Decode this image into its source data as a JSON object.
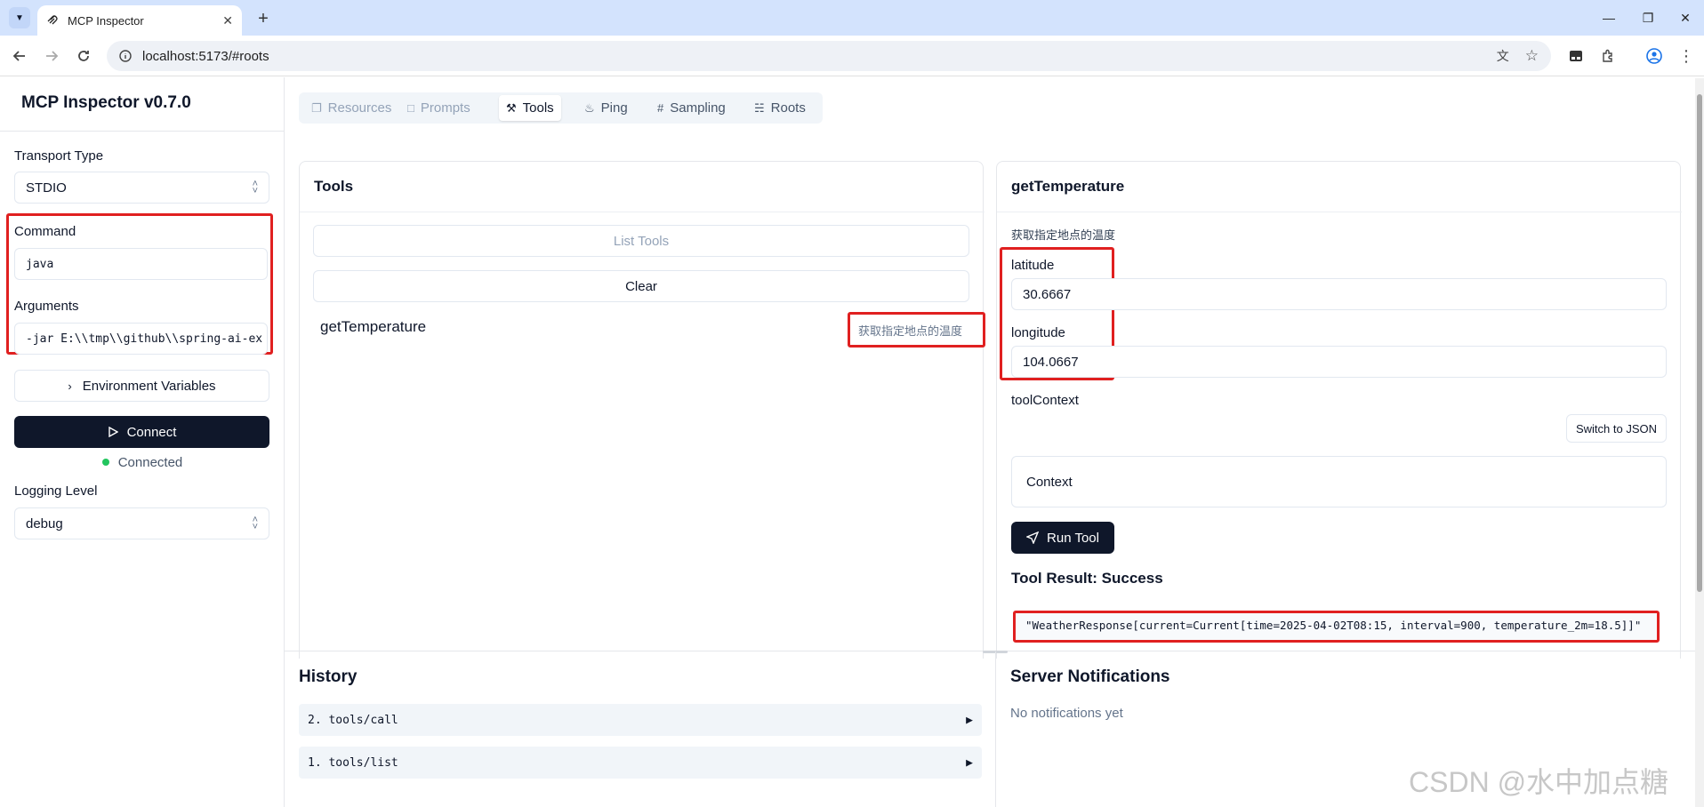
{
  "browser": {
    "tab_title": "MCP Inspector",
    "url": "localhost:5173/#roots"
  },
  "sidebar": {
    "app_title": "MCP Inspector v0.7.0",
    "transport_label": "Transport Type",
    "transport_value": "STDIO",
    "command_label": "Command",
    "command_value": "java",
    "arguments_label": "Arguments",
    "arguments_value": "-jar E:\\\\tmp\\\\github\\\\spring-ai-ex",
    "env_button": "Environment Variables",
    "connect_button": "Connect",
    "status": "Connected",
    "logging_label": "Logging Level",
    "logging_value": "debug"
  },
  "tabs": [
    {
      "label": "Resources",
      "icon": "files-icon"
    },
    {
      "label": "Prompts",
      "icon": "message-icon"
    },
    {
      "label": "Tools",
      "icon": "hammer-icon"
    },
    {
      "label": "Ping",
      "icon": "bell-icon"
    },
    {
      "label": "Sampling",
      "icon": "hash-icon"
    },
    {
      "label": "Roots",
      "icon": "folder-tree-icon"
    }
  ],
  "tools_panel": {
    "title": "Tools",
    "list_button": "List Tools",
    "clear_button": "Clear",
    "items": [
      {
        "name": "getTemperature",
        "description": "获取指定地点的温度"
      }
    ]
  },
  "detail_panel": {
    "title": "getTemperature",
    "description": "获取指定地点的温度",
    "latitude_label": "latitude",
    "latitude_value": "30.6667",
    "longitude_label": "longitude",
    "longitude_value": "104.0667",
    "context_label": "toolContext",
    "switch_button": "Switch to JSON",
    "context_placeholder": "Context",
    "run_button": "Run Tool",
    "result_title": "Tool Result: Success",
    "result_value": "\"WeatherResponse[current=Current[time=2025-04-02T08:15, interval=900, temperature_2m=18.5]]\""
  },
  "history": {
    "title": "History",
    "items": [
      "2. tools/call",
      "1. tools/list"
    ]
  },
  "notifications": {
    "title": "Server Notifications",
    "empty": "No notifications yet"
  },
  "watermark": "CSDN @水中加点糖",
  "colors": {
    "primary": "#0f172a",
    "highlight_red": "#e02020",
    "status_green": "#22c55e",
    "browser_tabstrip": "#d3e3fd"
  }
}
